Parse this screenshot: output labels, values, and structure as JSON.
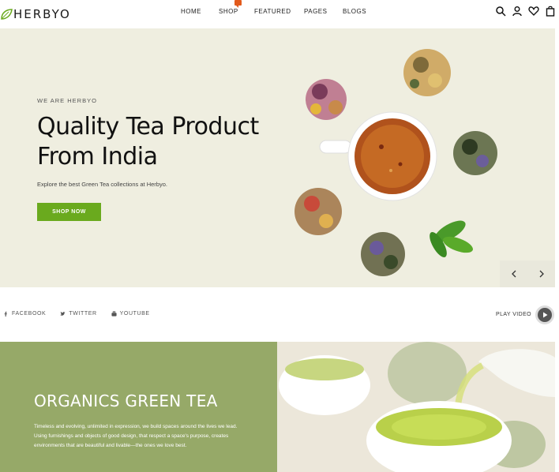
{
  "brand": {
    "name": "HERBYO",
    "accent_color": "#6aaa1e",
    "banner_color": "#96a968"
  },
  "nav": {
    "items": [
      "HOME",
      "SHOP",
      "FEATURED",
      "PAGES",
      "BLOGS"
    ]
  },
  "header_icons": [
    "search-icon",
    "user-icon",
    "heart-icon",
    "bag-icon"
  ],
  "hero": {
    "subtitle": "WE ARE HERBYO",
    "title_line1": "Quality Tea Product",
    "title_line2": "From India",
    "description": "Explore the best Green Tea collections at Herbyo.",
    "button_label": "SHOP NOW",
    "prev_icon": "chevron-left-icon",
    "next_icon": "chevron-right-icon"
  },
  "social": {
    "items": [
      {
        "label": "FACEBOOK",
        "icon": "facebook-icon"
      },
      {
        "label": "TWITTER",
        "icon": "twitter-icon"
      },
      {
        "label": "YOUTUBE",
        "icon": "youtube-icon"
      }
    ],
    "play_label": "PLAY VIDEO"
  },
  "banner": {
    "title": "ORGANICS GREEN TEA",
    "text": "Timeless and evolving, unlimited in expression, we build spaces around the lives we lead. Using furnishings and objects of good design, that respect a space's purpose, creates environments that are beautiful and livable—the ones we love best."
  }
}
